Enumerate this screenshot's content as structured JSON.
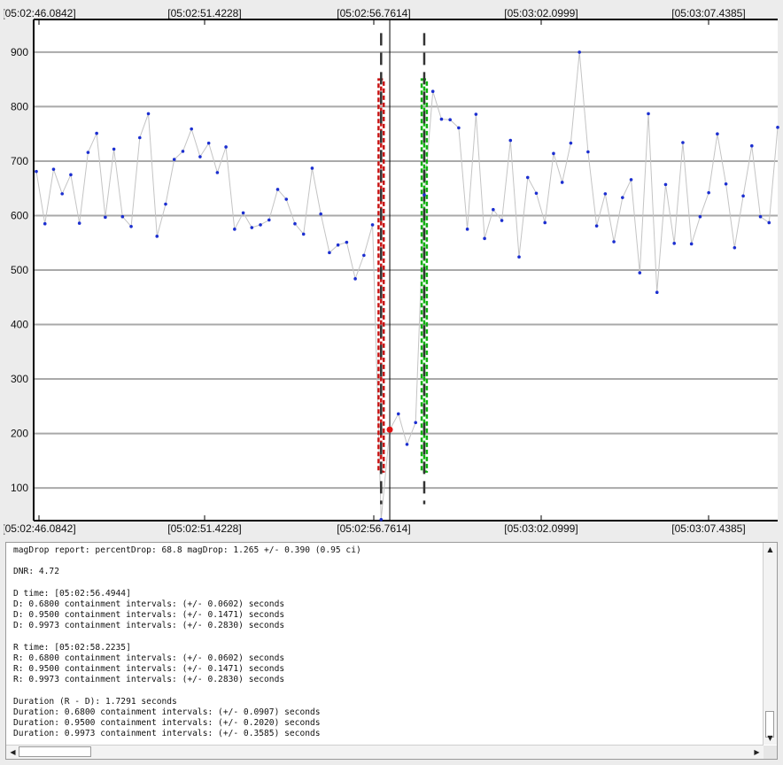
{
  "chart_data": {
    "type": "line",
    "title": "",
    "xlabel": "",
    "ylabel": "",
    "x_tick_labels": [
      "[05:02:46.0842]",
      "[05:02:51.4228]",
      "[05:02:56.7614]",
      "[05:03:02.0999]",
      "[05:03:07.4385]"
    ],
    "y_ticks": [
      100,
      200,
      300,
      400,
      500,
      600,
      700,
      800,
      900
    ],
    "ylim": [
      40,
      960
    ],
    "grid": true,
    "series": [
      {
        "values": [
          681,
          585,
          685,
          640,
          675,
          586,
          716,
          751,
          597,
          722,
          598,
          580,
          743,
          787,
          562,
          621,
          703,
          718,
          759,
          708,
          733,
          679,
          726,
          575,
          605,
          578,
          583,
          592,
          648,
          630,
          585,
          566,
          687,
          603,
          532,
          546,
          551,
          484,
          527,
          583,
          42,
          207,
          236,
          180,
          220,
          638,
          828,
          777,
          776,
          761,
          575,
          786,
          558,
          611,
          591,
          738,
          524,
          670,
          641,
          587,
          714,
          661,
          733,
          900,
          717,
          581,
          640,
          552,
          633,
          666,
          495,
          787,
          459,
          657,
          549,
          734,
          548,
          598,
          642,
          750,
          658,
          541,
          636,
          728,
          598,
          587,
          762
        ]
      }
    ],
    "highlight_point": {
      "index": 41,
      "value": 207,
      "color": "#e01010"
    },
    "markers": {
      "d_edge_index": 40.0,
      "r_edge_index": 45.0,
      "d_band_indices": [
        39.7,
        40.3
      ],
      "r_band_indices": [
        44.7,
        45.3
      ],
      "band_ylim": [
        130,
        850
      ],
      "d_color": "#c81414",
      "r_color": "#10b010",
      "dashed_line_color": "#333333"
    },
    "colors": {
      "line": "#c4c4c4",
      "point": "#1c2fd0",
      "grid": "#a9a9a9"
    }
  },
  "report": {
    "lines": [
      "magDrop report: percentDrop: 68.8 magDrop: 1.265 +/- 0.390 (0.95 ci)",
      "",
      "DNR: 4.72",
      "",
      "D time: [05:02:56.4944]",
      "D: 0.6800 containment intervals: (+/- 0.0602) seconds",
      "D: 0.9500 containment intervals: (+/- 0.1471) seconds",
      "D: 0.9973 containment intervals: (+/- 0.2830) seconds",
      "",
      "R time: [05:02:58.2235]",
      "R: 0.6800 containment intervals: (+/- 0.0602) seconds",
      "R: 0.9500 containment intervals: (+/- 0.1471) seconds",
      "R: 0.9973 containment intervals: (+/- 0.2830) seconds",
      "",
      "Duration (R - D): 1.7291 seconds",
      "Duration: 0.6800 containment intervals: (+/- 0.0907) seconds",
      "Duration: 0.9500 containment intervals: (+/- 0.2020) seconds",
      "Duration: 0.9973 containment intervals: (+/- 0.3585) seconds"
    ]
  }
}
